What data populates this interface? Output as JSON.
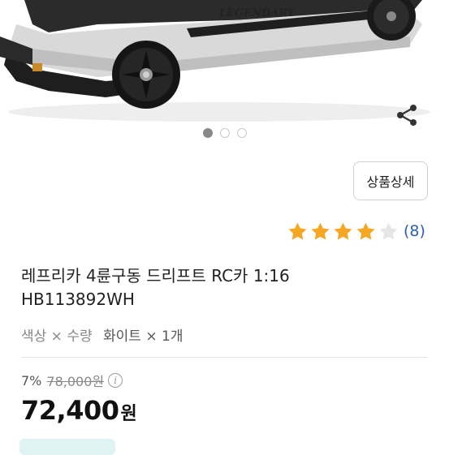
{
  "hero": {
    "decal_text": "LEGENDARY"
  },
  "gallery": {
    "total": 3,
    "active_index": 0
  },
  "actions": {
    "detail_label": "상품상세"
  },
  "rating": {
    "stars": 4,
    "max": 5,
    "review_count_text": "(8)"
  },
  "product": {
    "title_line1": "레프리카 4륜구동 드리프트 RC카 1:16",
    "title_line2": "HB113892WH",
    "option_label": "색상 × 수량",
    "option_value": "화이트 × 1개"
  },
  "pricing": {
    "discount_rate": "7%",
    "original_price": "78,000원",
    "final_price": "72,400",
    "currency": "원"
  },
  "colors": {
    "star": "#f5a623",
    "star_empty": "#e6e6e6",
    "review_count": "#2f5fb4",
    "chip": "#dff2f4"
  }
}
